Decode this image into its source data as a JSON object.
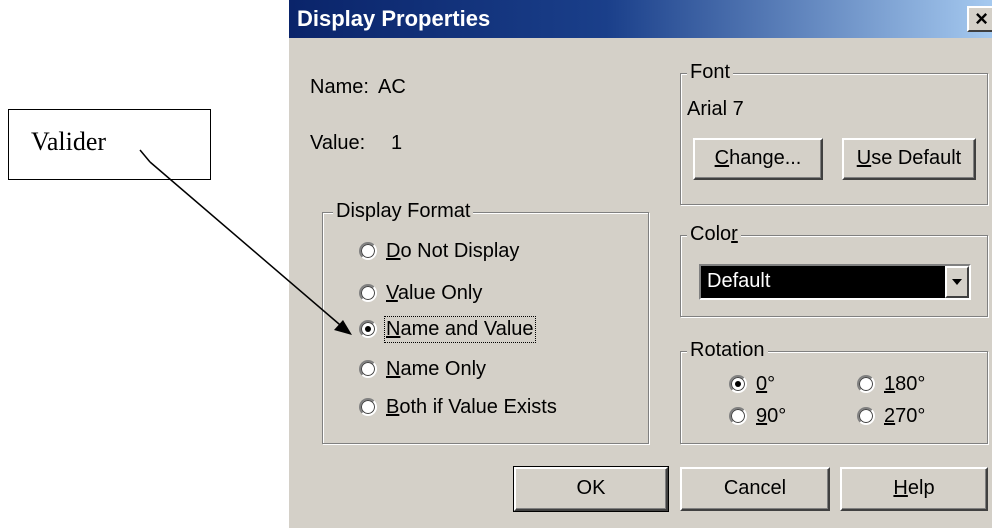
{
  "callout": {
    "text": "Valider"
  },
  "dialog": {
    "title": "Display Properties",
    "close_label": "×",
    "name_label": "Name:",
    "name_value": "AC",
    "value_label": "Value:",
    "value_value": "1"
  },
  "display_format": {
    "legend": "Display Format",
    "options": [
      {
        "mnemonic": "D",
        "rest": "o Not Display",
        "checked": false
      },
      {
        "mnemonic": "V",
        "rest": "alue Only",
        "checked": false
      },
      {
        "mnemonic": "N",
        "rest": "ame and Value",
        "checked": true
      },
      {
        "mnemonic": "N",
        "rest": "ame Only",
        "checked": false
      },
      {
        "mnemonic": "B",
        "rest": "oth if Value Exists",
        "checked": false
      }
    ]
  },
  "font": {
    "legend": "Font",
    "current": "Arial 7",
    "change_mnemonic": "C",
    "change_rest": "hange...",
    "usedefault_mnemonic": "U",
    "usedefault_rest": "se Default"
  },
  "color": {
    "legend_pre": "Colo",
    "legend_mnemonic": "r",
    "selected": "Default"
  },
  "rotation": {
    "legend": "Rotation",
    "options": [
      {
        "mnemonic": "0",
        "rest": "°",
        "checked": true
      },
      {
        "mnemonic": "1",
        "rest": "80°",
        "checked": false
      },
      {
        "mnemonic": "9",
        "rest": "0°",
        "checked": false
      },
      {
        "mnemonic": "2",
        "rest": "70°",
        "checked": false
      }
    ]
  },
  "buttons": {
    "ok": "OK",
    "cancel": "Cancel",
    "help_mnemonic": "H",
    "help_rest": "elp"
  }
}
